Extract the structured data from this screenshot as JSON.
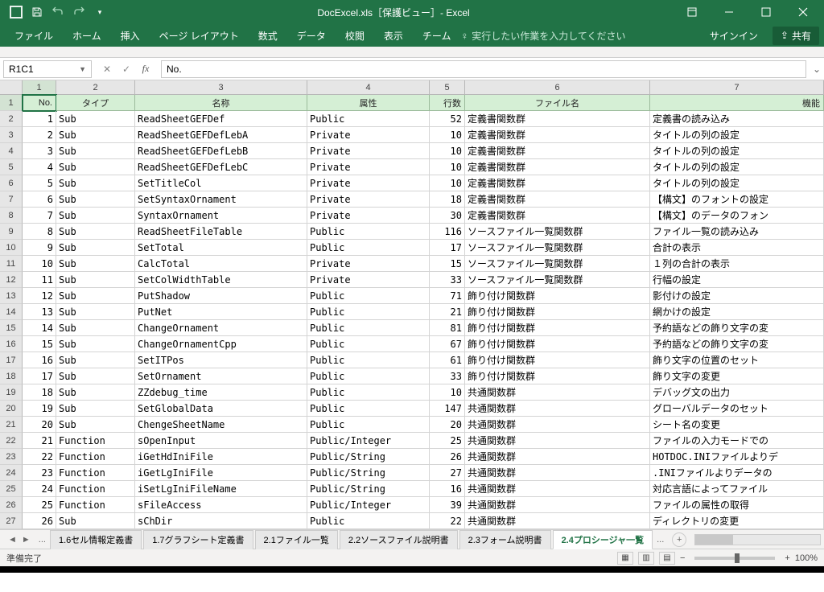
{
  "title": "DocExcel.xls［保護ビュー］- Excel",
  "qat": {
    "save": "save",
    "undo": "undo",
    "redo": "redo"
  },
  "win": {
    "signin": "サインイン",
    "share": "共有"
  },
  "ribbon": {
    "tabs": [
      "ファイル",
      "ホーム",
      "挿入",
      "ページ レイアウト",
      "数式",
      "データ",
      "校閲",
      "表示",
      "チーム"
    ],
    "tellme": "実行したい作業を入力してください"
  },
  "formula": {
    "namebox": "R1C1",
    "value": "No."
  },
  "colnums": [
    "1",
    "2",
    "3",
    "4",
    "5",
    "6",
    "7"
  ],
  "rownums": [
    "1",
    "2",
    "3",
    "4",
    "5",
    "6",
    "7",
    "8",
    "9",
    "10",
    "11",
    "12",
    "13",
    "14",
    "15",
    "16",
    "17",
    "18",
    "19",
    "20",
    "21",
    "22",
    "23",
    "24",
    "25",
    "26",
    "27"
  ],
  "headers": [
    "No.",
    "タイプ",
    "名称",
    "属性",
    "行数",
    "ファイル名",
    "機能"
  ],
  "rows": [
    [
      "1",
      "Sub",
      "ReadSheetGEFDef",
      "Public",
      "52",
      "定義書関数群",
      "定義書の読み込み"
    ],
    [
      "2",
      "Sub",
      "ReadSheetGEFDefLebA",
      "Private",
      "10",
      "定義書関数群",
      "タイトルの列の設定"
    ],
    [
      "3",
      "Sub",
      "ReadSheetGEFDefLebB",
      "Private",
      "10",
      "定義書関数群",
      "タイトルの列の設定"
    ],
    [
      "4",
      "Sub",
      "ReadSheetGEFDefLebC",
      "Private",
      "10",
      "定義書関数群",
      "タイトルの列の設定"
    ],
    [
      "5",
      "Sub",
      "SetTitleCol",
      "Private",
      "10",
      "定義書関数群",
      "タイトルの列の設定"
    ],
    [
      "6",
      "Sub",
      "SetSyntaxOrnament",
      "Private",
      "18",
      "定義書関数群",
      "【構文】のフォントの設定"
    ],
    [
      "7",
      "Sub",
      "SyntaxOrnament",
      "Private",
      "30",
      "定義書関数群",
      "【構文】のデータのフォン"
    ],
    [
      "8",
      "Sub",
      "ReadSheetFileTable",
      "Public",
      "116",
      "ソースファイル一覧関数群",
      "ファイル一覧の読み込み"
    ],
    [
      "9",
      "Sub",
      "SetTotal",
      "Public",
      "17",
      "ソースファイル一覧関数群",
      "合計の表示"
    ],
    [
      "10",
      "Sub",
      "CalcTotal",
      "Private",
      "15",
      "ソースファイル一覧関数群",
      "１列の合計の表示"
    ],
    [
      "11",
      "Sub",
      "SetColWidthTable",
      "Private",
      "33",
      "ソースファイル一覧関数群",
      "行幅の設定"
    ],
    [
      "12",
      "Sub",
      "PutShadow",
      "Public",
      "71",
      "飾り付け関数群",
      "影付けの設定"
    ],
    [
      "13",
      "Sub",
      "PutNet",
      "Public",
      "21",
      "飾り付け関数群",
      "網かけの設定"
    ],
    [
      "14",
      "Sub",
      "ChangeOrnament",
      "Public",
      "81",
      "飾り付け関数群",
      "予約語などの飾り文字の変"
    ],
    [
      "15",
      "Sub",
      "ChangeOrnamentCpp",
      "Public",
      "67",
      "飾り付け関数群",
      "予約語などの飾り文字の変"
    ],
    [
      "16",
      "Sub",
      "SetITPos",
      "Public",
      "61",
      "飾り付け関数群",
      "飾り文字の位置のセット"
    ],
    [
      "17",
      "Sub",
      "SetOrnament",
      "Public",
      "33",
      "飾り付け関数群",
      "飾り文字の変更"
    ],
    [
      "18",
      "Sub",
      "ZZdebug_time",
      "Public",
      "10",
      "共通関数群",
      "デバッグ文の出力"
    ],
    [
      "19",
      "Sub",
      "SetGlobalData",
      "Public",
      "147",
      "共通関数群",
      "グローバルデータのセット"
    ],
    [
      "20",
      "Sub",
      "ChengeSheetName",
      "Public",
      "20",
      "共通関数群",
      "シート名の変更"
    ],
    [
      "21",
      "Function",
      "sOpenInput",
      "Public/Integer",
      "25",
      "共通関数群",
      "ファイルの入力モードでの"
    ],
    [
      "22",
      "Function",
      "iGetHdIniFile",
      "Public/String",
      "26",
      "共通関数群",
      "HOTDOC.INIファイルよりデ"
    ],
    [
      "23",
      "Function",
      "iGetLgIniFile",
      "Public/String",
      "27",
      "共通関数群",
      ".INIファイルよりデータの"
    ],
    [
      "24",
      "Function",
      "iSetLgIniFileName",
      "Public/String",
      "16",
      "共通関数群",
      "対応言語によってファイル"
    ],
    [
      "25",
      "Function",
      "sFileAccess",
      "Public/Integer",
      "39",
      "共通関数群",
      "ファイルの属性の取得"
    ],
    [
      "26",
      "Sub",
      "sChDir",
      "Public",
      "22",
      "共通関数群",
      "ディレクトリの変更"
    ]
  ],
  "sheets": {
    "tabs": [
      "1.6セル情報定義書",
      "1.7グラフシート定義書",
      "2.1ファイル一覧",
      "2.2ソースファイル説明書",
      "2.3フォーム説明書",
      "2.4プロシージャ一覧"
    ],
    "active": 5
  },
  "status": {
    "ready": "準備完了",
    "zoom": "100%"
  }
}
